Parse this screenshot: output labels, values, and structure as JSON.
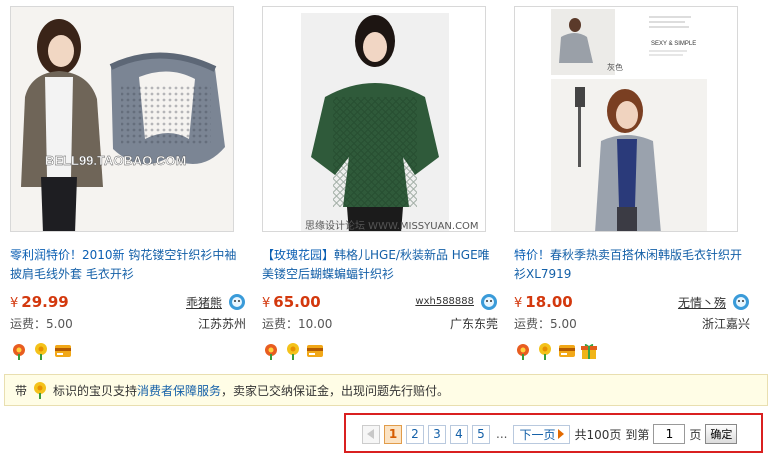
{
  "products": [
    {
      "title_lead": "零利润特价！2010新 ",
      "title_rest": "钩花镂空针织衫中袖披肩毛线外套 毛衣开衫",
      "price_symbol": "¥",
      "price": "29.99",
      "seller": "乖猪熊",
      "shipping": "运费：5.00",
      "location": "江苏苏州",
      "watermark": "BELL99.TAOBAO.COM",
      "badges": [
        "orange-flower-icon",
        "yellow-flower-icon",
        "card-icon"
      ]
    },
    {
      "title_lead": "【玫瑰花园】",
      "title_rest": "韩格儿HGE/秋装新品 HGE唯美镂空后蝴蝶蝙蝠针织衫",
      "price_symbol": "¥",
      "price": "65.00",
      "seller": "wxh588888",
      "shipping": "运费：10.00",
      "location": "广东东莞",
      "watermark": "思缘设计论坛  WWW.MISSYUAN.COM",
      "badges": [
        "orange-flower-icon",
        "yellow-flower-icon",
        "card-icon"
      ]
    },
    {
      "title_lead": "特价！",
      "title_rest": "春秋季热卖百搭休闲韩版毛衣针织开衫XL7919",
      "price_symbol": "¥",
      "price": "18.00",
      "seller": "无情丶殇",
      "shipping": "运费：5.00",
      "location": "浙江嘉兴",
      "image_label_1": "灰色",
      "image_label_2": "SEXY & SIMPLE",
      "badges": [
        "orange-flower-icon",
        "yellow-flower-icon",
        "card-icon",
        "gift-icon"
      ]
    }
  ],
  "notice": {
    "prefix": "带",
    "middle": "标识的宝贝支持",
    "link": "消费者保障服务",
    "suffix": "，卖家已交纳保证金，出现问题先行赔付。"
  },
  "pager": {
    "pages": [
      "1",
      "2",
      "3",
      "4",
      "5"
    ],
    "current": "1",
    "ellipsis": "...",
    "next_label": "下一页",
    "total_label": "共100页",
    "goto_label": "到第",
    "goto_value": "1",
    "page_unit": "页",
    "confirm_label": "确定"
  },
  "colors": {
    "price": "#d3380d",
    "link": "#1460a8",
    "pager_highlight_border": "#d92020",
    "notice_bg": "#fffde6"
  }
}
